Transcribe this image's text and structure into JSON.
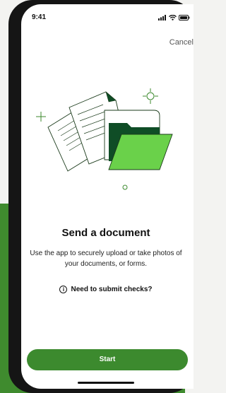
{
  "status_bar": {
    "time": "9:41",
    "icons": [
      "cellular-signal-icon",
      "wifi-icon",
      "battery-icon"
    ]
  },
  "header": {
    "cancel_label": "Cancel"
  },
  "main": {
    "title": "Send a document",
    "description": "Use the app to securely upload or take photos of your documents, or forms.",
    "checks_link": {
      "icon": "info-icon",
      "icon_glyph": "i",
      "label": "Need to submit checks?"
    },
    "start_label": "Start"
  },
  "colors": {
    "brand_green": "#3c8a2e",
    "folder_light": "#6ad14a",
    "folder_dark": "#0f4d26",
    "background_panel": "#f3f3f1"
  }
}
